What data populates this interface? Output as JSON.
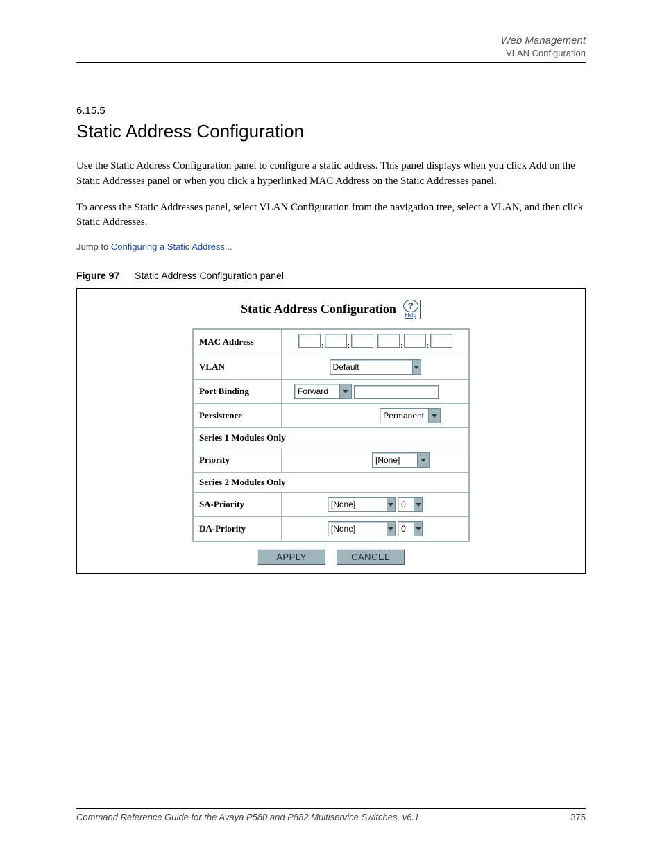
{
  "header": {
    "line1": "Web Management",
    "line2": "VLAN Configuration"
  },
  "section": {
    "number": "6.15.5",
    "title": "Static Address Configuration"
  },
  "paragraphs": [
    "Use the Static Address Configuration panel to configure a static address. This panel displays when you click Add on the Static Addresses panel or when you click a hyperlinked MAC Address on the Static Addresses panel.",
    "To access the Static Addresses panel, select VLAN Configuration from the navigation tree, select a VLAN, and then click Static Addresses."
  ],
  "jump": {
    "prefix": "Jump to ",
    "link": "Configuring a Static Address",
    "suffix": "..."
  },
  "figure": {
    "label": "Figure 97",
    "caption": "Static Address Configuration panel"
  },
  "panel": {
    "title": "Static Address Configuration",
    "help_glyph": "?",
    "help_text": "Help",
    "rows": {
      "mac_label": "MAC Address",
      "vlan_label": "VLAN",
      "vlan_value": "Default",
      "portbind_label": "Port Binding",
      "portbind_value": "Forward",
      "persist_label": "Persistence",
      "persist_value": "Permanent",
      "s1_header": "Series 1 Modules Only",
      "priority_label": "Priority",
      "priority_value": "[None]",
      "s2_header": "Series 2 Modules Only",
      "sa_label": "SA-Priority",
      "sa_value": "[None]",
      "sa_num": "0",
      "da_label": "DA-Priority",
      "da_value": "[None]",
      "da_num": "0"
    },
    "buttons": {
      "apply": "APPLY",
      "cancel": "CANCEL"
    }
  },
  "footer": {
    "left": "Command Reference Guide for the Avaya P580 and P882 Multiservice Switches, v6.1",
    "right": "375"
  }
}
